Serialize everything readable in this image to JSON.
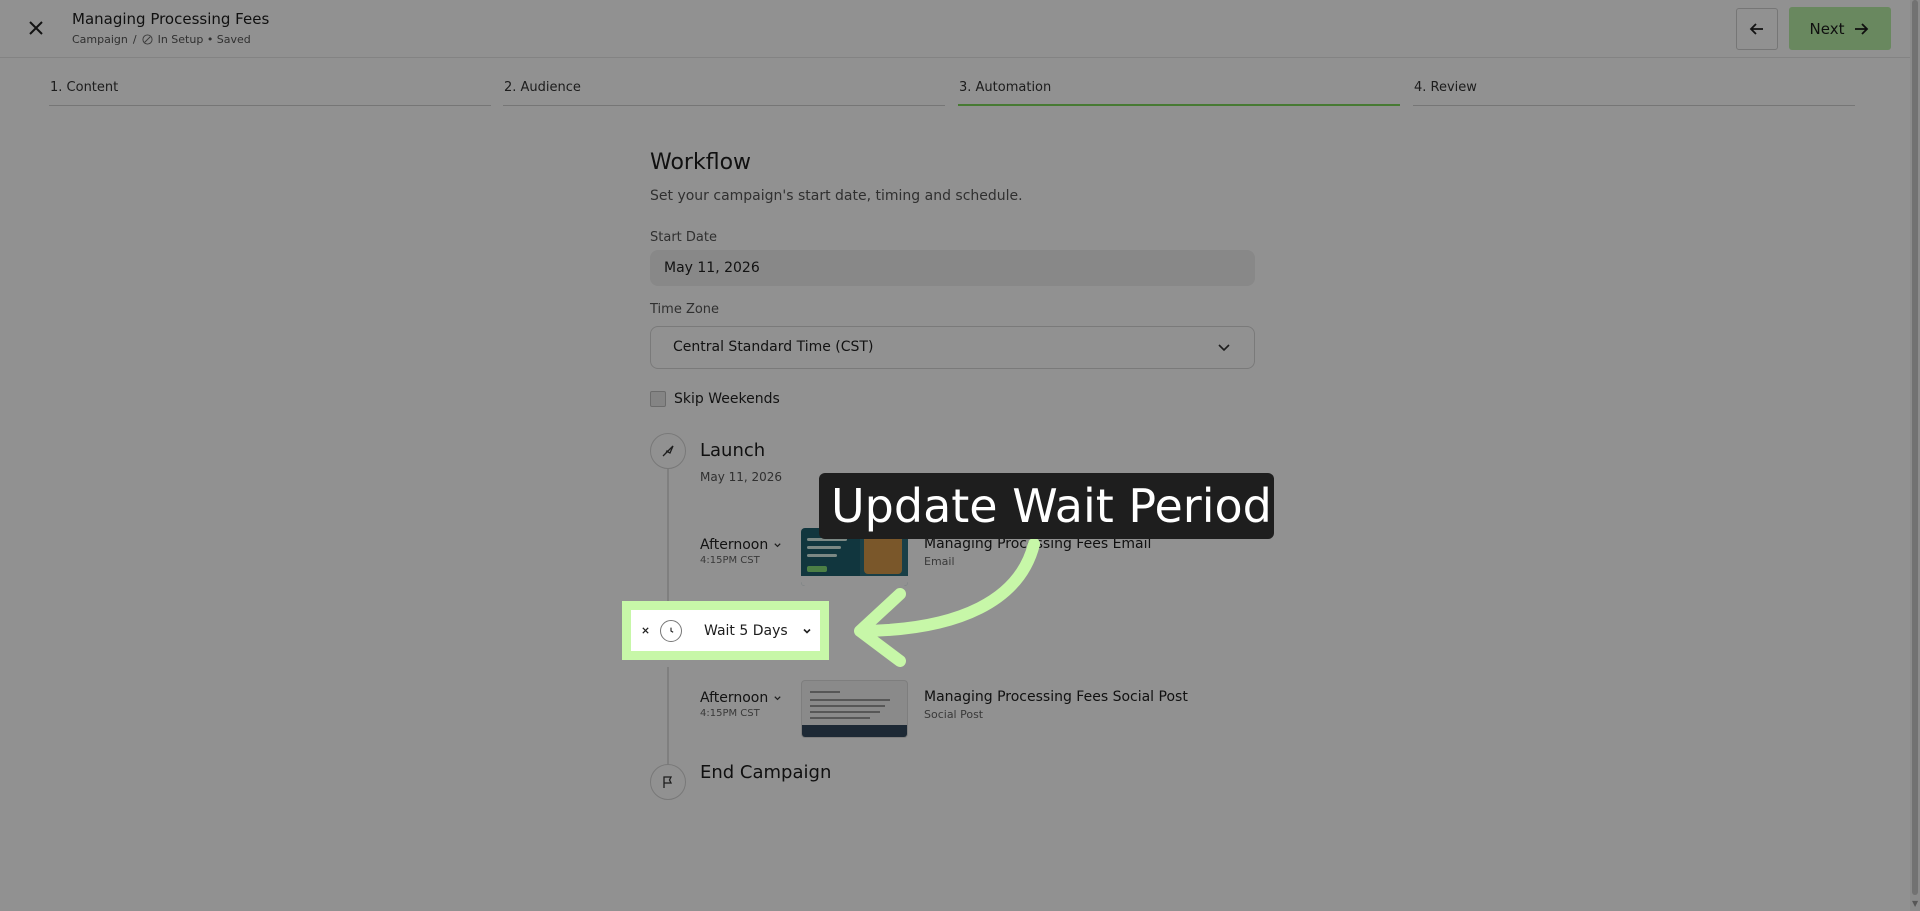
{
  "header": {
    "title": "Managing Processing Fees",
    "breadcrumb_root": "Campaign",
    "breadcrumb_sep": "/",
    "status": "In Setup • Saved",
    "next_label": "Next"
  },
  "steps": [
    {
      "label": "1.  Content",
      "active": false
    },
    {
      "label": "2.  Audience",
      "active": false
    },
    {
      "label": "3.  Automation",
      "active": true
    },
    {
      "label": "4.  Review",
      "active": false
    }
  ],
  "workflow": {
    "heading": "Workflow",
    "subtitle": "Set your campaign's start date, timing and schedule.",
    "start_date_label": "Start Date",
    "start_date_value": "May 11, 2026",
    "timezone_label": "Time Zone",
    "timezone_value": "Central Standard Time (CST)",
    "skip_weekends_label": "Skip Weekends",
    "skip_weekends_checked": false
  },
  "timeline": {
    "launch_title": "Launch",
    "launch_date": "May 11, 2026",
    "items": [
      {
        "when": "Afternoon",
        "time": "4:15PM CST",
        "title": "Managing Processing Fees Email",
        "type": "Email"
      },
      {
        "when": "Afternoon",
        "time": "4:15PM CST",
        "title": "Managing Processing Fees Social Post",
        "type": "Social Post"
      }
    ],
    "wait_label": "Wait 5 Days",
    "end_title": "End Campaign"
  },
  "annotation": {
    "callout_text": "Update Wait Period",
    "highlight_color": "#c7f7a8",
    "callout_bg": "#1e1e1e"
  },
  "colors": {
    "accent": "#b9f0a7",
    "active_step": "#7dd65a"
  }
}
